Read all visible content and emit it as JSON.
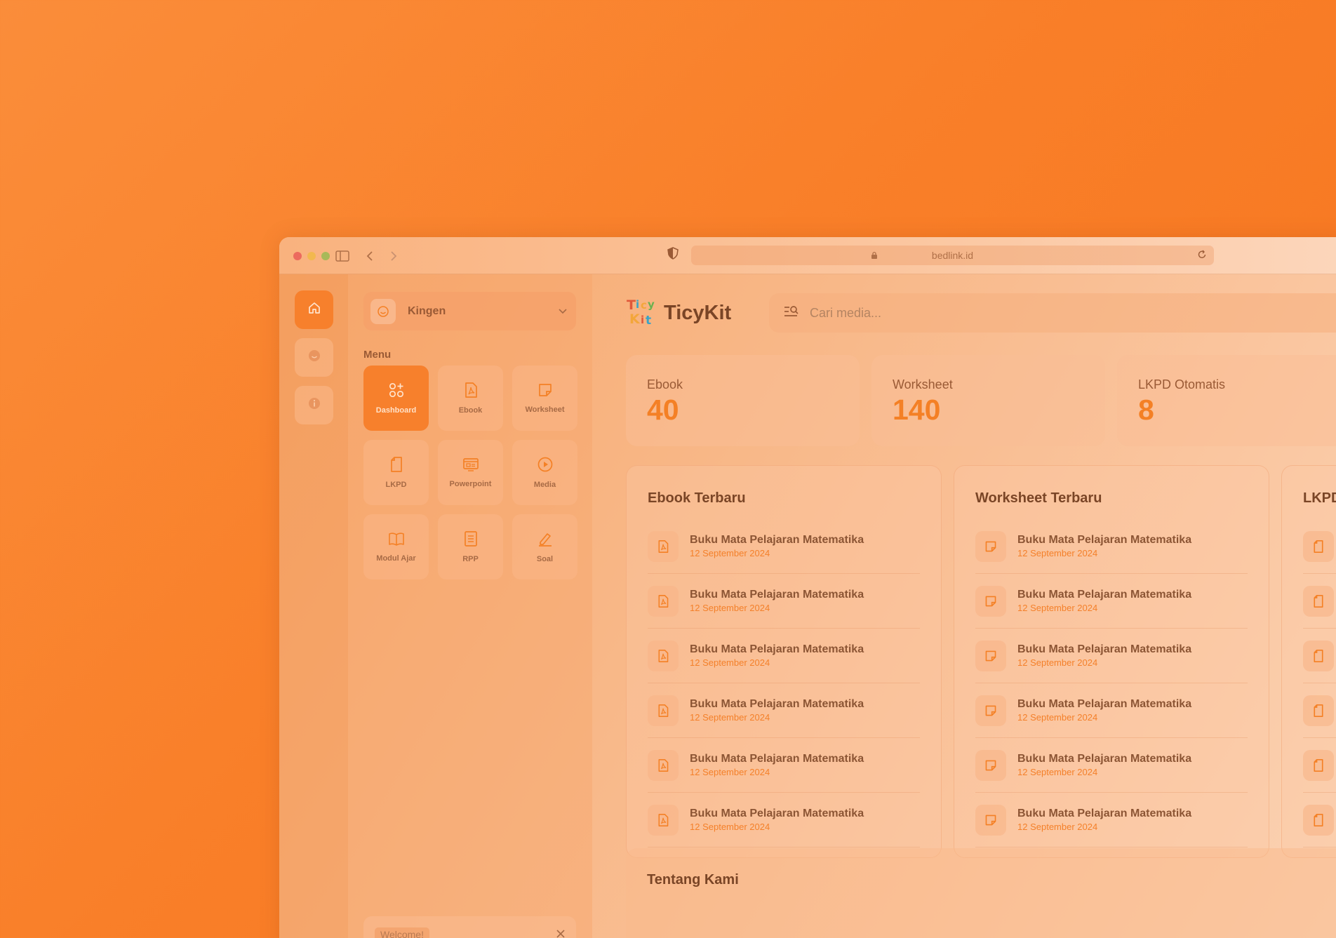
{
  "browser": {
    "url": "bedlink.id"
  },
  "rail": {
    "items": [
      "home-icon",
      "smile-icon",
      "info-icon"
    ]
  },
  "sidebar": {
    "user_name": "Kingen",
    "menu_label": "Menu",
    "menu_items": [
      {
        "label": "Dashboard",
        "icon": "dashboard-icon",
        "active": true
      },
      {
        "label": "Ebook",
        "icon": "pdf-file-icon"
      },
      {
        "label": "Worksheet",
        "icon": "note-icon"
      },
      {
        "label": "LKPD",
        "icon": "document-icon"
      },
      {
        "label": "Powerpoint",
        "icon": "presentation-icon"
      },
      {
        "label": "Media",
        "icon": "play-icon"
      },
      {
        "label": "Modul Ajar",
        "icon": "book-icon"
      },
      {
        "label": "RPP",
        "icon": "list-document-icon"
      },
      {
        "label": "Soal",
        "icon": "pen-icon"
      }
    ],
    "welcome_text": "Welcome!"
  },
  "header": {
    "brand": "TicyKit",
    "search_placeholder": "Cari media..."
  },
  "stats": [
    {
      "label": "Ebook",
      "value": "40"
    },
    {
      "label": "Worksheet",
      "value": "140"
    },
    {
      "label": "LKPD Otomatis",
      "value": "8"
    }
  ],
  "panels": [
    {
      "title": "Ebook Terbaru",
      "icon": "pdf-file-icon",
      "items": [
        {
          "title": "Buku Mata Pelajaran Matematika",
          "date": "12 September 2024"
        },
        {
          "title": "Buku Mata Pelajaran Matematika",
          "date": "12 September 2024"
        },
        {
          "title": "Buku Mata Pelajaran Matematika",
          "date": "12 September 2024"
        },
        {
          "title": "Buku Mata Pelajaran Matematika",
          "date": "12 September 2024"
        },
        {
          "title": "Buku Mata Pelajaran Matematika",
          "date": "12 September 2024"
        },
        {
          "title": "Buku Mata Pelajaran Matematika",
          "date": "12 September 2024"
        }
      ]
    },
    {
      "title": "Worksheet Terbaru",
      "icon": "note-icon",
      "items": [
        {
          "title": "Buku Mata Pelajaran Matematika",
          "date": "12 September 2024"
        },
        {
          "title": "Buku Mata Pelajaran Matematika",
          "date": "12 September 2024"
        },
        {
          "title": "Buku Mata Pelajaran Matematika",
          "date": "12 September 2024"
        },
        {
          "title": "Buku Mata Pelajaran Matematika",
          "date": "12 September 2024"
        },
        {
          "title": "Buku Mata Pelajaran Matematika",
          "date": "12 September 2024"
        },
        {
          "title": "Buku Mata Pelajaran Matematika",
          "date": "12 September 2024"
        }
      ]
    },
    {
      "title": "LKPD",
      "icon": "document-icon",
      "items": [
        {
          "title": "",
          "date": ""
        },
        {
          "title": "",
          "date": ""
        },
        {
          "title": "",
          "date": ""
        },
        {
          "title": "",
          "date": ""
        },
        {
          "title": "",
          "date": ""
        },
        {
          "title": "",
          "date": ""
        }
      ]
    }
  ],
  "about": {
    "title": "Tentang Kami"
  },
  "colors": {
    "accent": "#f7802c",
    "background": "#f97f29"
  }
}
